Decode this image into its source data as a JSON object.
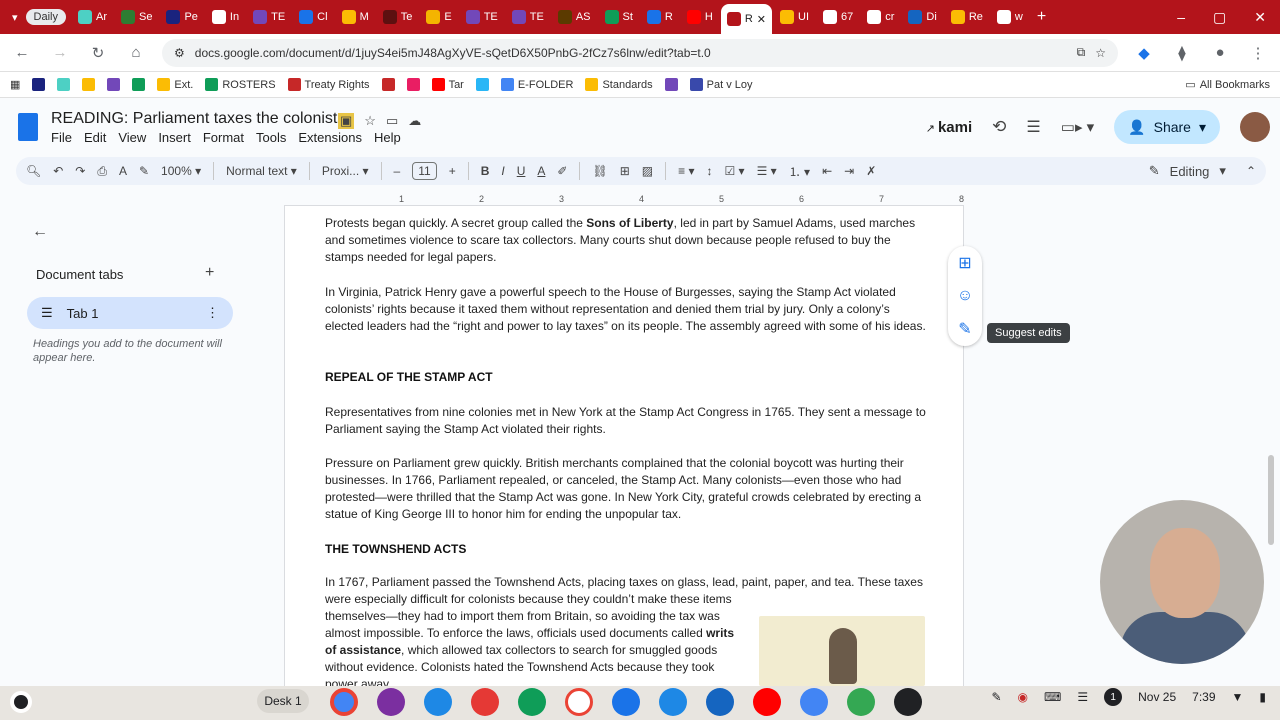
{
  "browser": {
    "tab_group": "Daily",
    "tabs": [
      "Ar",
      "Se",
      "Pe",
      "In",
      "TE",
      "Cl",
      "M",
      "Te",
      "E",
      "TE",
      "TE",
      "AS",
      "St",
      "R",
      "H",
      "R",
      "UI",
      "67",
      "cr",
      "Di",
      "Re",
      "w"
    ],
    "url": "docs.google.com/document/d/1juyS4ei5mJ48AgXyVE-sQetD6X50PnbG-2fCz7s6lnw/edit?tab=t.0",
    "bookmarks": [
      "Ext.",
      "ROSTERS",
      "Treaty Rights",
      "Tar",
      "E-FOLDER",
      "Standards",
      "Pat v Loy"
    ],
    "all_bookmarks": "All Bookmarks",
    "accent": "#b3141b"
  },
  "doc": {
    "title": "READING: Parliament taxes the colonists",
    "menu": [
      "File",
      "Edit",
      "View",
      "Insert",
      "Format",
      "Tools",
      "Extensions",
      "Help"
    ],
    "kami": "kami",
    "share": "Share"
  },
  "toolbar": {
    "zoom": "100%",
    "style": "Normal text",
    "font": "Proxi...",
    "font_size": "11",
    "mode": "Editing"
  },
  "ruler": [
    "1",
    "2",
    "3",
    "4",
    "5",
    "6",
    "7",
    "8"
  ],
  "outline": {
    "title": "Document tabs",
    "tab": "Tab 1",
    "hint": "Headings you add to the document will appear here."
  },
  "content": {
    "p1_a": "Protests began quickly. A secret group called the ",
    "p1_b": "Sons of Liberty",
    "p1_c": ", led in part by Samuel Adams, used marches and sometimes violence to scare tax collectors. Many courts shut down because people refused to buy the stamps needed for legal papers.",
    "p2": "In Virginia, Patrick Henry gave a powerful speech to the House of Burgesses, saying the Stamp Act violated colonists’ rights because it taxed them without representation and denied them trial by jury. Only a colony’s elected leaders had the “right and power to lay taxes” on its people. The assembly agreed with some of his ideas.",
    "h1": "REPEAL OF THE STAMP ACT",
    "p3": "Representatives from nine colonies met in New York at the Stamp Act Congress in 1765. They sent a message to Parliament saying the Stamp Act violated their rights.",
    "p4": "Pressure on Parliament grew quickly. British merchants complained that the colonial boycott was hurting their businesses. In 1766, Parliament repealed, or canceled, the Stamp Act. Many colonists—even those who had protested—were thrilled that the Stamp Act was gone. In New York City, grateful crowds celebrated by erecting a statue of King George III to honor him for ending the unpopular tax.",
    "h2": "THE TOWNSHEND ACTS",
    "p5": "In 1767, Parliament passed the Townshend Acts, placing taxes on glass, lead, paint, paper, and tea. These taxes",
    "p6_a": "were especially difficult for colonists because they couldn’t make these items themselves—they had to import them from Britain, so avoiding the tax was almost impossible. To enforce the laws, officials used documents called ",
    "p6_b": "writs of assistance",
    "p6_c": ", which allowed tax collectors to search for smuggled goods without evidence. Colonists hated the Townshend Acts because they took power away"
  },
  "tooltip": "Suggest edits",
  "shelf": {
    "desk": "Desk 1",
    "notif_count": "1",
    "date": "Nov 25",
    "time": "7:39"
  }
}
